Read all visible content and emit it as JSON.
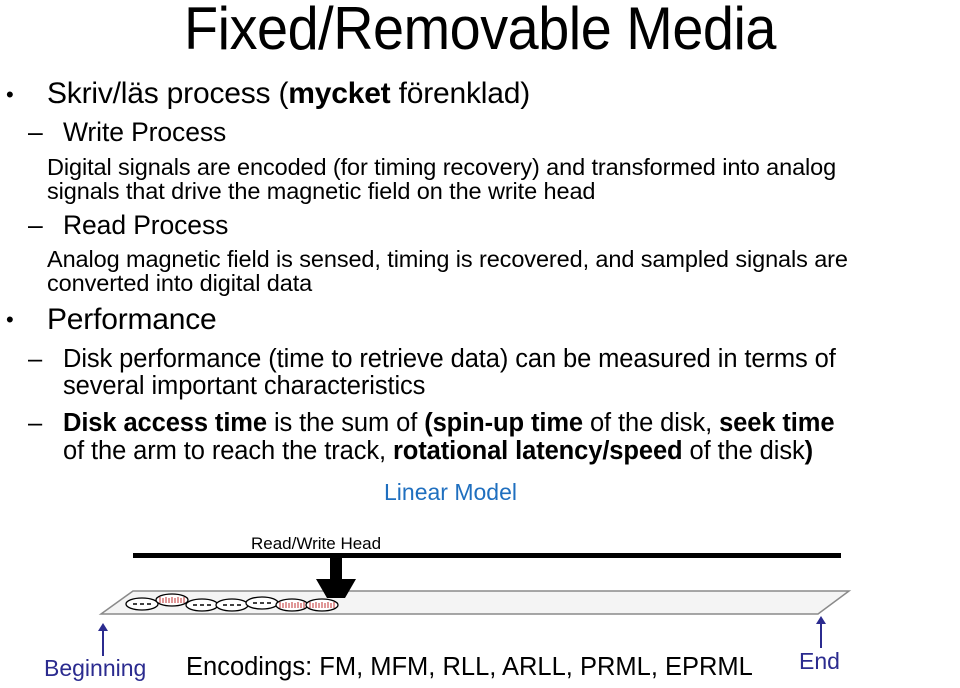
{
  "title": "Fixed/Removable Media",
  "bullets": [
    {
      "text_pre": "Skriv/läs process (",
      "text_bold": "mycket",
      "text_post": " förenklad)",
      "sub": [
        {
          "label": "Write Process",
          "body_lines": [
            "Digital signals are encoded (for timing recovery) and transformed into analog",
            "signals that drive the magnetic field on the write head"
          ]
        },
        {
          "label": "Read Process",
          "body_lines": [
            "Analog magnetic field is sensed, timing is recovered, and sampled signals are",
            "converted into digital data"
          ]
        }
      ]
    },
    {
      "text": "Performance",
      "sub": [
        {
          "lines": [
            "Disk performance (time to retrieve data) can be measured in terms of",
            "several important characteristics"
          ]
        },
        {
          "line1": [
            {
              "t": "Disk access time",
              "b": true
            },
            {
              "t": " is the sum of ",
              "b": false
            },
            {
              "t": "(spin-up time",
              "b": true
            },
            {
              "t": " of the disk, ",
              "b": false
            },
            {
              "t": "seek time",
              "b": true
            }
          ],
          "line2": [
            {
              "t": "of the arm to reach the track, ",
              "b": false
            },
            {
              "t": "rotational latency/speed",
              "b": true
            },
            {
              "t": " of the disk",
              "b": false
            },
            {
              "t": ")",
              "b": true
            }
          ]
        }
      ]
    }
  ],
  "bullet_glyph": "•",
  "dash_glyph": "–",
  "diagram": {
    "caption": "Linear Model",
    "head_label": "Read/Write Head",
    "begin_label": "Beginning",
    "end_label": "End",
    "encodings": "Encodings: FM, MFM, RLL, ARLL, PRML, EPRML",
    "cells": [
      "dash",
      "tick",
      "dash",
      "dash",
      "dash",
      "tick",
      "tick"
    ],
    "colors": {
      "caption": "#1f6fbf",
      "arrow": "#2b2b8f",
      "tick": "#c03030",
      "track_fill": "#f4f4f4",
      "track_edge": "#888888"
    }
  }
}
